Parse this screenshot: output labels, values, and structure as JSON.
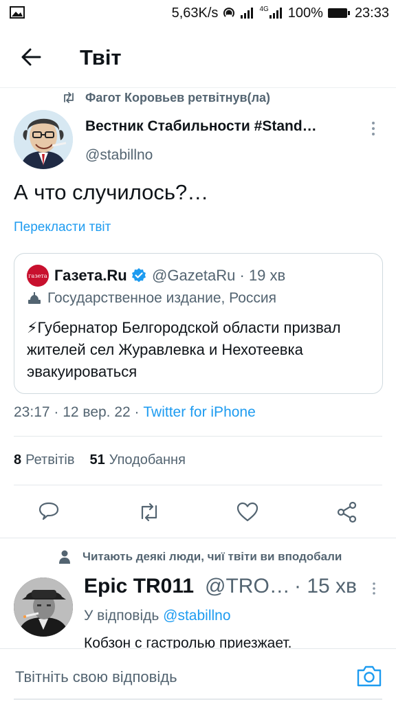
{
  "status_bar": {
    "network_speed": "5,63K/s",
    "signal_label": "4G",
    "battery": "100%",
    "time": "23:33",
    "icons": [
      "image-icon",
      "hotspot-icon",
      "signal-icon",
      "signal-4g-icon",
      "battery-icon"
    ]
  },
  "header": {
    "title": "Твіт",
    "back_icon": "arrow-left-icon"
  },
  "retweet_context": {
    "text": "Фагот Коровьев ретвітнув(ла)",
    "icon": "retweet-icon"
  },
  "tweet": {
    "author_name": "Вестник Стабильности #Stand…",
    "author_handle": "@stabillno",
    "text": "А что случилось?…",
    "translate": "Перекласти твіт",
    "timestamp": "23:17 · 12 вер. 22 · ",
    "source": "Twitter for iPhone"
  },
  "quote": {
    "logo_text": "газета",
    "name": "Газета.Ru",
    "handle_time": "@GazetaRu · 19 хв",
    "label": "Государственное издание, Россия",
    "text": "⚡Губернатор Белгородской области призвал жителей сел Журавлевка и Нехотеевка эвакуироваться"
  },
  "stats": {
    "retweets_count": "8",
    "retweets_label": "Ретвітів",
    "likes_count": "51",
    "likes_label": "Уподобання"
  },
  "actions": [
    "reply-icon",
    "retweet-icon",
    "like-icon",
    "share-icon"
  ],
  "recommendation": {
    "context": "Читають деякі люди, чиї твіти ви вподобали",
    "name": "Epic TR011",
    "handle": "@TRO…",
    "time": "· 15 хв",
    "reply_to_label": "У відповідь ",
    "reply_to_mention": "@stabillno",
    "text": "Кобзон с гастролью приезжает."
  },
  "composer": {
    "placeholder": "Твітніть свою відповідь",
    "camera_icon": "camera-icon"
  },
  "colors": {
    "accent": "#1d9bf0",
    "secondary_text": "#536471",
    "primary_text": "#0f1419",
    "divider": "#e4e8eb",
    "verified": "#1d9bf0",
    "gazeta_red": "#c8102e"
  }
}
